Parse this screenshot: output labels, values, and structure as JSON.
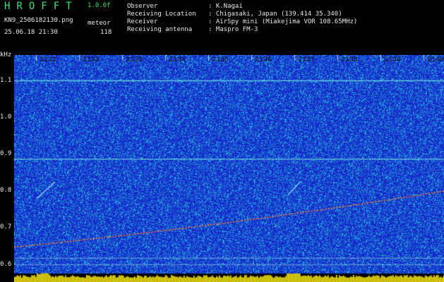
{
  "header": {
    "logo": "HROFFT",
    "version": "1.0.0f",
    "filename": "KN9_2506182130.png",
    "datetime": "25.06.18 21:30",
    "mode_label": "meteor",
    "count": "118",
    "fields": [
      {
        "label": "Observer",
        "value": ": K.Nagai"
      },
      {
        "label": "Receiving Location",
        "value": ": Chigasaki, Japan (139.414 35.340)"
      },
      {
        "label": "Receiver",
        "value": ": AirSpy mini (Miakejima VOR 108.65MHz)"
      },
      {
        "label": "Receiving antenna",
        "value": ": Maspro FM-3"
      }
    ]
  },
  "spectrogram": {
    "y_unit": "kHz",
    "y_ticks": [
      "1.1",
      "1.0",
      "0.9",
      "0.8",
      "0.7",
      "0.6"
    ],
    "y_range": [
      0.58,
      1.17
    ],
    "x_ticks": [
      "2131",
      "2132",
      "2133",
      "2134",
      "2135",
      "2136",
      "2137",
      "2138",
      "2139",
      "2140"
    ],
    "colors": {
      "background": "#1a2bd0",
      "noise_high": "#27c6e0",
      "line": "#ff7a2a",
      "bar": "#ffee00"
    }
  }
}
